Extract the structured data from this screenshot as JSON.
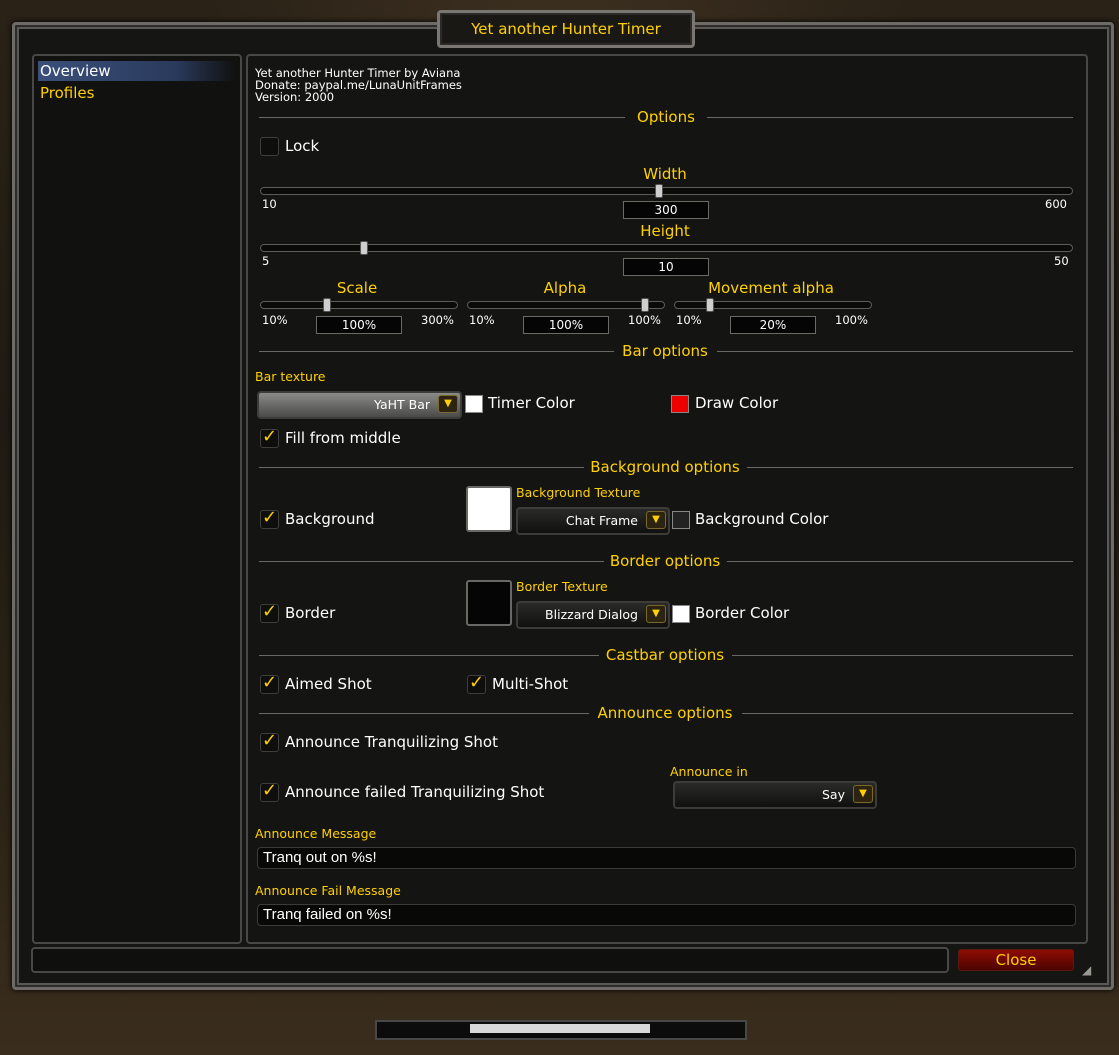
{
  "window": {
    "title": "Yet another Hunter Timer"
  },
  "tree": {
    "items": [
      {
        "label": "Overview",
        "selected": true
      },
      {
        "label": "Profiles",
        "selected": false
      }
    ]
  },
  "info": {
    "line1": "Yet another Hunter Timer by Aviana",
    "line2": "Donate: paypal.me/LunaUnitFrames",
    "line3": "Version: 2000"
  },
  "options": {
    "header": "Options",
    "lock": {
      "label": "Lock",
      "checked": false
    },
    "width": {
      "label": "Width",
      "min": "10",
      "max": "600",
      "value": "300",
      "fraction": 0.5
    },
    "height": {
      "label": "Height",
      "min": "5",
      "max": "50",
      "value": "10",
      "fraction": 0.11
    },
    "scale": {
      "label": "Scale",
      "min": "10%",
      "max": "300%",
      "value": "100%",
      "fraction": 0.31
    },
    "alpha": {
      "label": "Alpha",
      "min": "10%",
      "max": "100%",
      "value": "100%",
      "fraction": 1.0
    },
    "movement_alpha": {
      "label": "Movement alpha",
      "min": "10%",
      "max": "100%",
      "value": "20%",
      "fraction": 0.11
    }
  },
  "bar_options": {
    "header": "Bar options",
    "texture_label": "Bar texture",
    "texture_value": "YaHT Bar",
    "timer_color": {
      "label": "Timer Color",
      "color": "#ffffff"
    },
    "draw_color": {
      "label": "Draw Color",
      "color": "#ee0000"
    },
    "fill_from_middle": {
      "label": "Fill from middle",
      "checked": true
    }
  },
  "background_options": {
    "header": "Background options",
    "background": {
      "label": "Background",
      "checked": true
    },
    "texture_label": "Background Texture",
    "texture_value": "Chat Frame",
    "color_label": "Background Color",
    "preview_color": "#ffffff"
  },
  "border_options": {
    "header": "Border options",
    "border": {
      "label": "Border",
      "checked": true
    },
    "texture_label": "Border Texture",
    "texture_value": "Blizzard Dialog",
    "color_label": "Border Color",
    "color": "#ffffff",
    "preview_color": "#050505"
  },
  "castbar_options": {
    "header": "Castbar options",
    "aimed_shot": {
      "label": "Aimed Shot",
      "checked": true
    },
    "multi_shot": {
      "label": "Multi-Shot",
      "checked": true
    }
  },
  "announce_options": {
    "header": "Announce options",
    "announce_tranq": {
      "label": "Announce Tranquilizing Shot",
      "checked": true
    },
    "announce_failed": {
      "label": "Announce failed Tranquilizing Shot",
      "checked": true
    },
    "announce_in_label": "Announce in",
    "announce_in_value": "Say",
    "message_label": "Announce Message",
    "message_value": "Tranq out on %s!",
    "fail_message_label": "Announce Fail Message",
    "fail_message_value": "Tranq failed on %s!"
  },
  "footer": {
    "close_label": "Close"
  },
  "icons": {
    "check": "checkmark-icon",
    "dropdown": "dropdown-arrow-icon",
    "resize": "resize-grip-icon"
  }
}
